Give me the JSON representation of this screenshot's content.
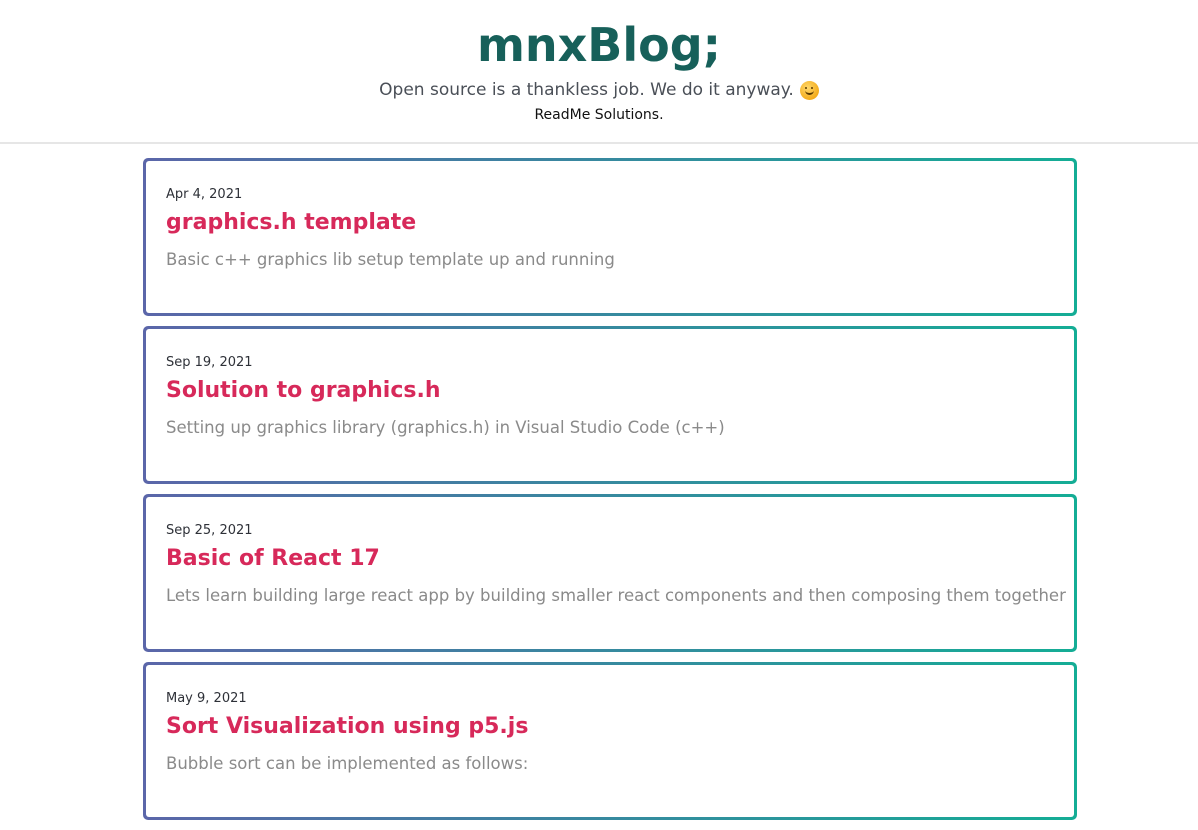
{
  "header": {
    "title": "mnxBlog;",
    "tagline": "Open source is a thankless job. We do it anyway.",
    "tagline_emoji_icon": "smiling-face-icon",
    "subtitle": "ReadMe Solutions."
  },
  "colors": {
    "title": "#17605a",
    "post_title": "#d7295a",
    "card_gradient_start": "#5b66a9",
    "card_gradient_end": "#14ad95",
    "excerpt": "#8a8a8a"
  },
  "posts": [
    {
      "date": "Apr 4, 2021",
      "title": "graphics.h template",
      "excerpt": "Basic c++ graphics lib setup template up and running"
    },
    {
      "date": "Sep 19, 2021",
      "title": "Solution to graphics.h",
      "excerpt": "Setting up graphics library (graphics.h) in Visual Studio Code (c++)"
    },
    {
      "date": "Sep 25, 2021",
      "title": "Basic of React 17",
      "excerpt": "Lets learn building large react app by building smaller react components and then composing them together"
    },
    {
      "date": "May 9, 2021",
      "title": "Sort Visualization using p5.js",
      "excerpt": "Bubble sort can be implemented as follows:"
    }
  ]
}
